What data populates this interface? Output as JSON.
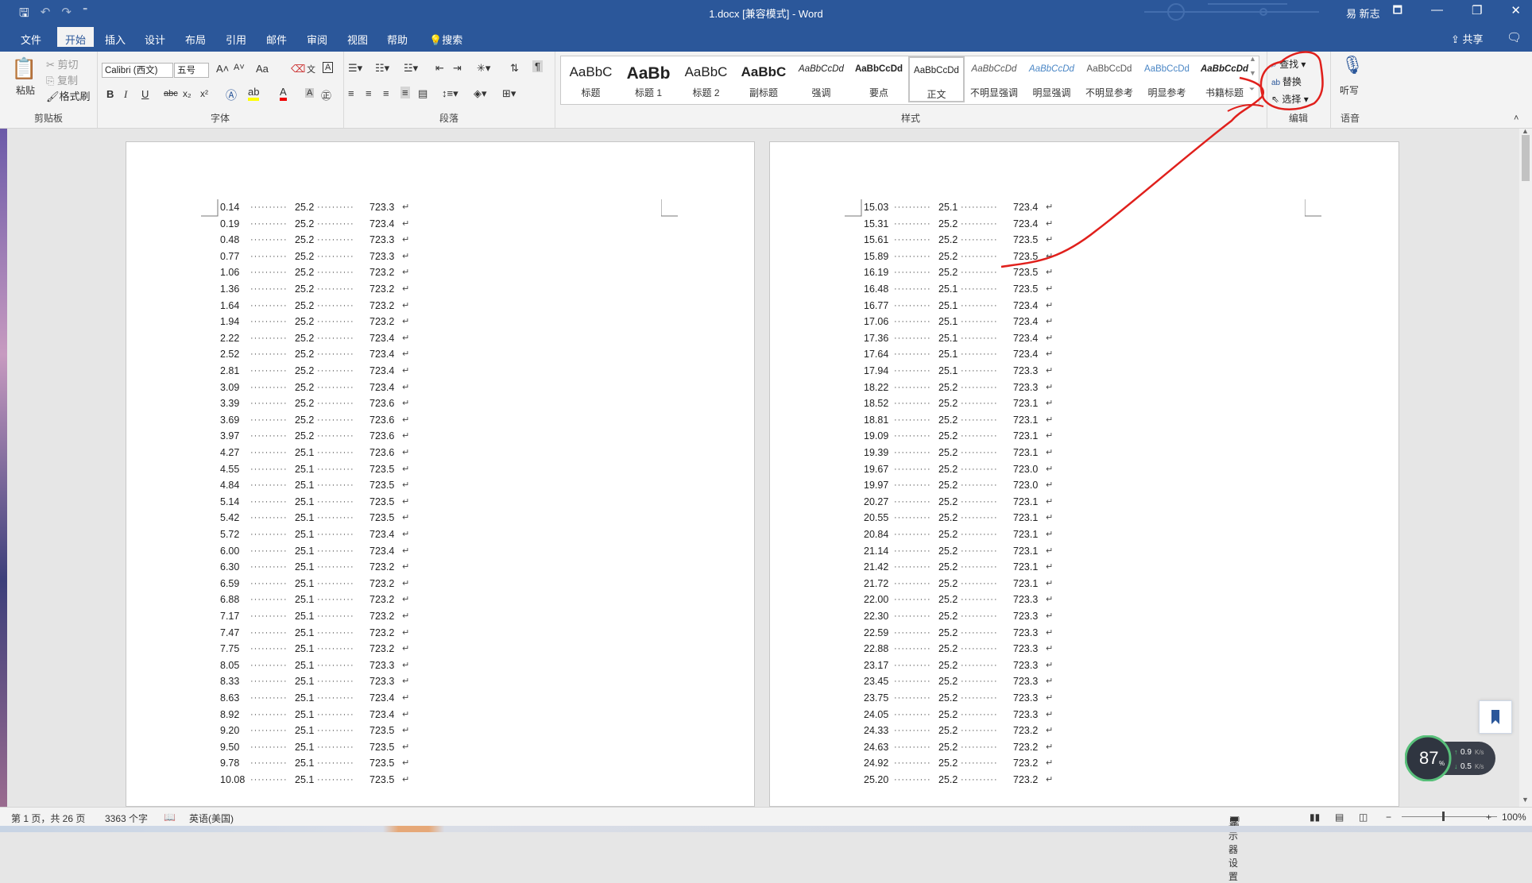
{
  "titlebar": {
    "title": "1.docx [兼容模式] - Word",
    "user": "易 新志",
    "quick_access_glyphs": [
      "🖫",
      "↶",
      "↷",
      "⁼"
    ],
    "window_glyphs": [
      "🗖",
      "—",
      "❐",
      "✕"
    ]
  },
  "tabs": {
    "items": [
      "文件",
      "开始",
      "插入",
      "设计",
      "布局",
      "引用",
      "邮件",
      "审阅",
      "视图",
      "帮助",
      "搜索"
    ],
    "active": "开始",
    "share": "共享"
  },
  "clipboard": {
    "paste": "粘贴",
    "cut": "剪切",
    "copy": "复制",
    "format_painter": "格式刷",
    "group": "剪贴板"
  },
  "font": {
    "name": "Calibri (西文)",
    "size": "五号",
    "grow": "A˄",
    "shrink": "A˅",
    "case": "Aa",
    "bold": "B",
    "italic": "I",
    "underline": "U",
    "strike": "abc",
    "sub": "x₂",
    "sup": "x²",
    "group": "字体"
  },
  "paragraph": {
    "group": "段落"
  },
  "styles": {
    "group": "样式",
    "items": [
      {
        "preview": "AaBbC",
        "name": "标题"
      },
      {
        "preview": "AaBb",
        "name": "标题 1"
      },
      {
        "preview": "AaBbC",
        "name": "标题 2"
      },
      {
        "preview": "AaBbC",
        "name": "副标题"
      },
      {
        "preview": "AaBbCcDd",
        "name": "强调"
      },
      {
        "preview": "AaBbCcDd",
        "name": "要点"
      },
      {
        "preview": "AaBbCcDd",
        "name": "正文"
      },
      {
        "preview": "AaBbCcDd",
        "name": "不明显强调"
      },
      {
        "preview": "AaBbCcDd",
        "name": "明显强调"
      },
      {
        "preview": "AaBbCcDd",
        "name": "不明显参考"
      },
      {
        "preview": "AaBbCcDd",
        "name": "明显参考"
      },
      {
        "preview": "AaBbCcDd",
        "name": "书籍标题"
      }
    ],
    "selected": "正文"
  },
  "editing": {
    "find": "查找",
    "replace": "替换",
    "select": "选择",
    "group": "编辑"
  },
  "voice": {
    "dictate": "听写",
    "group": "语音"
  },
  "colors": {
    "accent": "#2b579a",
    "annotation": "#e0201c"
  },
  "page1_rows": [
    [
      "0.14",
      "25.2",
      "723.3"
    ],
    [
      "0.19",
      "25.2",
      "723.4"
    ],
    [
      "0.48",
      "25.2",
      "723.3"
    ],
    [
      "0.77",
      "25.2",
      "723.3"
    ],
    [
      "1.06",
      "25.2",
      "723.2"
    ],
    [
      "1.36",
      "25.2",
      "723.2"
    ],
    [
      "1.64",
      "25.2",
      "723.2"
    ],
    [
      "1.94",
      "25.2",
      "723.2"
    ],
    [
      "2.22",
      "25.2",
      "723.4"
    ],
    [
      "2.52",
      "25.2",
      "723.4"
    ],
    [
      "2.81",
      "25.2",
      "723.4"
    ],
    [
      "3.09",
      "25.2",
      "723.4"
    ],
    [
      "3.39",
      "25.2",
      "723.6"
    ],
    [
      "3.69",
      "25.2",
      "723.6"
    ],
    [
      "3.97",
      "25.2",
      "723.6"
    ],
    [
      "4.27",
      "25.1",
      "723.6"
    ],
    [
      "4.55",
      "25.1",
      "723.5"
    ],
    [
      "4.84",
      "25.1",
      "723.5"
    ],
    [
      "5.14",
      "25.1",
      "723.5"
    ],
    [
      "5.42",
      "25.1",
      "723.5"
    ],
    [
      "5.72",
      "25.1",
      "723.4"
    ],
    [
      "6.00",
      "25.1",
      "723.4"
    ],
    [
      "6.30",
      "25.1",
      "723.2"
    ],
    [
      "6.59",
      "25.1",
      "723.2"
    ],
    [
      "6.88",
      "25.1",
      "723.2"
    ],
    [
      "7.17",
      "25.1",
      "723.2"
    ],
    [
      "7.47",
      "25.1",
      "723.2"
    ],
    [
      "7.75",
      "25.1",
      "723.2"
    ],
    [
      "8.05",
      "25.1",
      "723.3"
    ],
    [
      "8.33",
      "25.1",
      "723.3"
    ],
    [
      "8.63",
      "25.1",
      "723.4"
    ],
    [
      "8.92",
      "25.1",
      "723.4"
    ],
    [
      "9.20",
      "25.1",
      "723.5"
    ],
    [
      "9.50",
      "25.1",
      "723.5"
    ],
    [
      "9.78",
      "25.1",
      "723.5"
    ],
    [
      "10.08",
      "25.1",
      "723.5"
    ]
  ],
  "page2_rows": [
    [
      "15.03",
      "25.1",
      "723.4"
    ],
    [
      "15.31",
      "25.2",
      "723.4"
    ],
    [
      "15.61",
      "25.2",
      "723.5"
    ],
    [
      "15.89",
      "25.2",
      "723.5"
    ],
    [
      "16.19",
      "25.2",
      "723.5"
    ],
    [
      "16.48",
      "25.1",
      "723.5"
    ],
    [
      "16.77",
      "25.1",
      "723.4"
    ],
    [
      "17.06",
      "25.1",
      "723.4"
    ],
    [
      "17.36",
      "25.1",
      "723.4"
    ],
    [
      "17.64",
      "25.1",
      "723.4"
    ],
    [
      "17.94",
      "25.1",
      "723.3"
    ],
    [
      "18.22",
      "25.2",
      "723.3"
    ],
    [
      "18.52",
      "25.2",
      "723.1"
    ],
    [
      "18.81",
      "25.2",
      "723.1"
    ],
    [
      "19.09",
      "25.2",
      "723.1"
    ],
    [
      "19.39",
      "25.2",
      "723.1"
    ],
    [
      "19.67",
      "25.2",
      "723.0"
    ],
    [
      "19.97",
      "25.2",
      "723.0"
    ],
    [
      "20.27",
      "25.2",
      "723.1"
    ],
    [
      "20.55",
      "25.2",
      "723.1"
    ],
    [
      "20.84",
      "25.2",
      "723.1"
    ],
    [
      "21.14",
      "25.2",
      "723.1"
    ],
    [
      "21.42",
      "25.2",
      "723.1"
    ],
    [
      "21.72",
      "25.2",
      "723.1"
    ],
    [
      "22.00",
      "25.2",
      "723.3"
    ],
    [
      "22.30",
      "25.2",
      "723.3"
    ],
    [
      "22.59",
      "25.2",
      "723.3"
    ],
    [
      "22.88",
      "25.2",
      "723.3"
    ],
    [
      "23.17",
      "25.2",
      "723.3"
    ],
    [
      "23.45",
      "25.2",
      "723.3"
    ],
    [
      "23.75",
      "25.2",
      "723.3"
    ],
    [
      "24.05",
      "25.2",
      "723.3"
    ],
    [
      "24.33",
      "25.2",
      "723.2"
    ],
    [
      "24.63",
      "25.2",
      "723.2"
    ],
    [
      "24.92",
      "25.2",
      "723.2"
    ],
    [
      "25.20",
      "25.2",
      "723.2"
    ]
  ],
  "statusbar": {
    "page": "第 1 页，共 26 页",
    "words": "3363 个字",
    "language": "英语(美国)",
    "display": "显示器设置",
    "zoom": "100%"
  },
  "network": {
    "percent": "87",
    "up": "0.9",
    "down": "0.5",
    "unit": "K/s"
  }
}
